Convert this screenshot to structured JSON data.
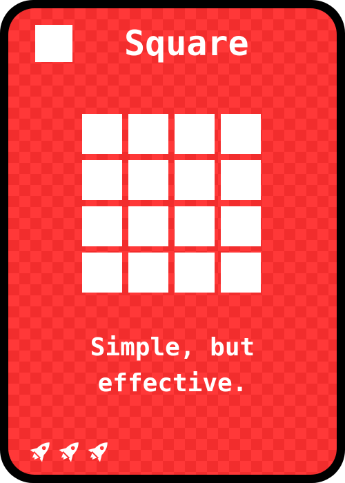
{
  "card": {
    "title": "Square",
    "corner_icon": "square-icon",
    "art_icon": "square-grid-icon",
    "grid": {
      "rows": 4,
      "cols": 4
    },
    "flavor_text": "Simple, but\neffective.",
    "cost": {
      "count": 3,
      "icon": "rocket-icon"
    },
    "colors": {
      "card_face": "#ff3838",
      "checker": "#f22d2d",
      "border": "#000000",
      "ink": "#ffffff"
    }
  }
}
